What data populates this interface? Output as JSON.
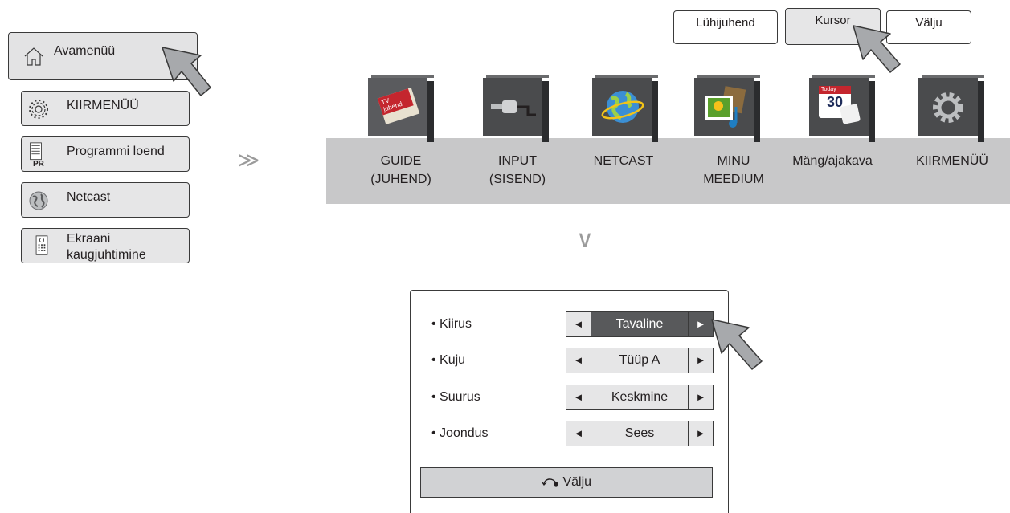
{
  "left_menu": {
    "items": [
      {
        "icon": "home-icon",
        "label": "Avamenüü"
      },
      {
        "icon": "gear-icon",
        "label": "KIIRMENÜÜ"
      },
      {
        "icon": "channel-list-icon",
        "label": "Programmi loend",
        "icon_text": "PR"
      },
      {
        "icon": "globe-icon",
        "label": "Netcast"
      },
      {
        "icon": "remote-icon",
        "label_line1": "Ekraani",
        "label_line2": "kaugjuhtimine"
      }
    ]
  },
  "arrows": {
    "right": "≫",
    "down": "∨"
  },
  "shortcut_buttons": [
    "Lühijuhend",
    "Kursor",
    "Välju"
  ],
  "ribbon": {
    "items": [
      {
        "icon": "tv-guide-icon",
        "icon_text": "TV juhend",
        "line1": "GUIDE",
        "line2": "(JUHEND)"
      },
      {
        "icon": "input-plug-icon",
        "line1": "INPUT",
        "line2": "(SISEND)"
      },
      {
        "icon": "netcast-globe-icon",
        "line1": "NETCAST",
        "line2": ""
      },
      {
        "icon": "media-icon",
        "line1": "MINU",
        "line2": "MEEDIUM"
      },
      {
        "icon": "calendar-game-icon",
        "icon_text": "Today",
        "icon_number": "30",
        "line1": "Mäng/ajakava",
        "line2": ""
      },
      {
        "icon": "settings-gear-icon",
        "line1": "KIIRMENÜÜ",
        "line2": ""
      }
    ]
  },
  "dialog": {
    "rows": [
      {
        "label": "• Kiirus",
        "value": "Tavaline",
        "active": true
      },
      {
        "label": "• Kuju",
        "value": "Tüüp A",
        "active": false
      },
      {
        "label": "• Suurus",
        "value": "Keskmine",
        "active": false
      },
      {
        "label": "• Joondus",
        "value": "Sees",
        "active": false
      }
    ],
    "left_arrow": "◄",
    "right_arrow": "►",
    "exit_label": "Välju"
  },
  "colors": {
    "ribbon": "#c8c8c9",
    "tile": "#4a4b4d",
    "active": "#58595b",
    "button": "#e6e6e7"
  }
}
